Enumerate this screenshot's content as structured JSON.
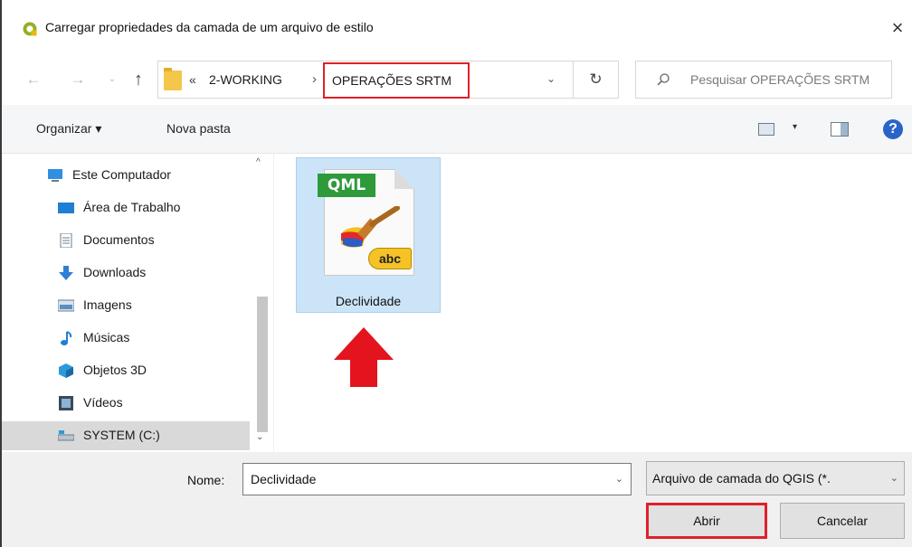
{
  "window": {
    "title": "Carregar propriedades da camada de um arquivo de estilo",
    "close_glyph": "×",
    "app_icon": "qgis-icon"
  },
  "nav": {
    "back_glyph": "←",
    "forward_glyph": "→",
    "recent_glyph": "⌄",
    "up_glyph": "↑",
    "breadcrumb_overflow": "«",
    "breadcrumb_parent": "2-WORKING",
    "breadcrumb_separator": "›",
    "breadcrumb_current": "OPERAÇÕES SRTM",
    "address_dropdown_glyph": "⌄",
    "refresh_glyph": "↻",
    "search_placeholder": "Pesquisar OPERAÇÕES SRTM"
  },
  "toolbar": {
    "organize_label": "Organizar ▾",
    "new_folder_label": "Nova pasta",
    "view_dropdown_glyph": "▾",
    "help_glyph": "?"
  },
  "sidebar": {
    "items": [
      {
        "label": "Este Computador",
        "icon": "computer-icon"
      },
      {
        "label": "Área de Trabalho",
        "icon": "desktop-icon"
      },
      {
        "label": "Documentos",
        "icon": "documents-icon"
      },
      {
        "label": "Downloads",
        "icon": "downloads-icon"
      },
      {
        "label": "Imagens",
        "icon": "pictures-icon"
      },
      {
        "label": "Músicas",
        "icon": "music-icon"
      },
      {
        "label": "Objetos 3D",
        "icon": "3d-objects-icon"
      },
      {
        "label": "Vídeos",
        "icon": "videos-icon"
      },
      {
        "label": "SYSTEM (C:)",
        "icon": "drive-icon"
      }
    ],
    "scroll_up_glyph": "^",
    "scroll_down_glyph": "⌄"
  },
  "files": [
    {
      "name": "Declividade",
      "badge": "QML",
      "sub_badge": "abc",
      "selected": true
    }
  ],
  "footer": {
    "name_label": "Nome:",
    "name_value": "Declividade",
    "dropdown_glyph": "⌄",
    "file_type": "Arquivo de camada do QGIS (*.",
    "open_label": "Abrir",
    "cancel_label": "Cancelar"
  },
  "colors": {
    "highlight_red": "#e0202a",
    "selection_blue": "#cce4f7",
    "qml_green": "#2e9a3a",
    "abc_yellow": "#f5c326"
  }
}
